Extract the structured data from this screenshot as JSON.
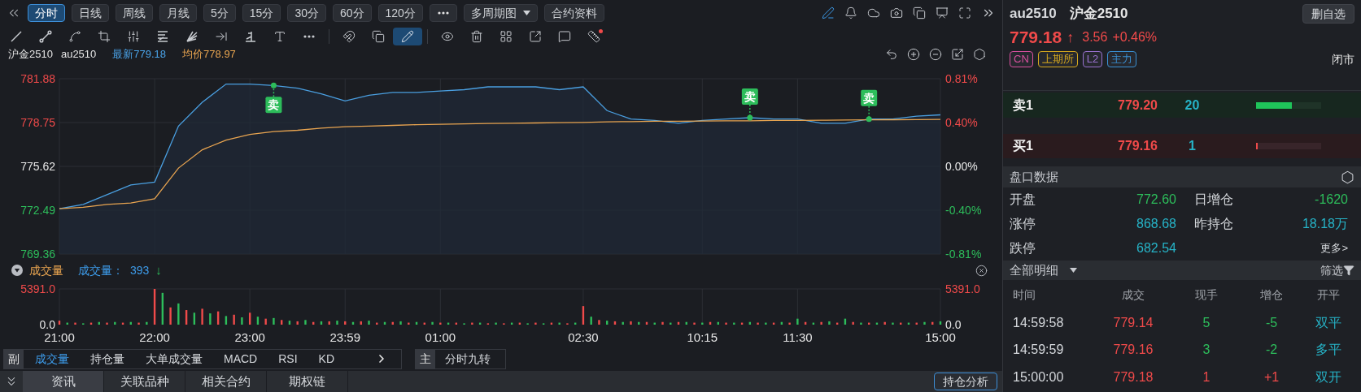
{
  "periods": [
    {
      "label": "分时",
      "selected": true
    },
    {
      "label": "日线",
      "selected": false
    },
    {
      "label": "周线",
      "selected": false
    },
    {
      "label": "月线",
      "selected": false
    },
    {
      "label": "5分",
      "selected": false
    },
    {
      "label": "15分",
      "selected": false
    },
    {
      "label": "30分",
      "selected": false
    },
    {
      "label": "60分",
      "selected": false
    },
    {
      "label": "120分",
      "selected": false
    }
  ],
  "period_menus": [
    {
      "label": "多周期图",
      "kind": "dropdown"
    },
    {
      "label": "合约资料",
      "kind": "plain"
    }
  ],
  "top_actions": [
    {
      "kind": "pen",
      "active": true
    },
    {
      "kind": "bell",
      "active": false
    },
    {
      "kind": "cloud",
      "active": false
    },
    {
      "kind": "camera",
      "active": false
    },
    {
      "kind": "copy",
      "active": false
    },
    {
      "kind": "monitor",
      "active": false
    },
    {
      "kind": "fullscreen",
      "active": false
    },
    {
      "kind": "expand",
      "active": false
    }
  ],
  "drawing_tools": [
    {
      "kind": "line",
      "selected": false
    },
    {
      "kind": "segment",
      "selected": false
    },
    {
      "kind": "path",
      "selected": false
    },
    {
      "kind": "crop",
      "selected": false
    },
    {
      "kind": "sliders",
      "selected": false
    },
    {
      "kind": "fib",
      "selected": false
    },
    {
      "kind": "fan",
      "selected": false
    },
    {
      "kind": "measure",
      "selected": false
    },
    {
      "kind": "angle",
      "selected": false
    },
    {
      "kind": "text",
      "selected": false
    },
    {
      "kind": "more",
      "selected": false
    }
  ],
  "edit_tools": [
    {
      "kind": "magnet",
      "selected": false
    },
    {
      "kind": "layers",
      "selected": false
    },
    {
      "kind": "pencil",
      "selected": true
    }
  ],
  "view_tools": [
    {
      "kind": "eye"
    },
    {
      "kind": "trash"
    },
    {
      "kind": "grid"
    },
    {
      "kind": "export"
    },
    {
      "kind": "comment"
    },
    {
      "kind": "ruler",
      "alert": true
    }
  ],
  "quote_line": {
    "name": "沪金2510",
    "code": "au2510",
    "last": "最新779.18",
    "avg": "均价778.97"
  },
  "price_chart": {
    "right_axis": [
      "0.81%",
      "0.40%",
      "0.00%",
      "-0.40%",
      "-0.81%"
    ],
    "chart_data": {
      "type": "area",
      "grid": true,
      "categories": [
        null,
        null,
        null,
        null,
        null,
        null,
        null,
        null,
        null,
        null,
        null,
        null,
        null,
        null,
        null,
        null,
        null,
        null,
        null,
        null,
        null,
        null,
        null,
        null,
        null,
        null,
        null,
        null,
        null,
        null,
        null,
        null,
        null,
        null,
        null,
        null,
        null,
        null
      ],
      "series": [
        {
          "type": "area",
          "color": "#4a9fe0",
          "values": [
            772.6,
            772.9,
            773.6,
            774.3,
            774.5,
            778.5,
            780.2,
            781.5,
            781.5,
            781.4,
            781.2,
            780.8,
            780.3,
            780.7,
            780.9,
            780.9,
            781.0,
            781.1,
            781.3,
            781.3,
            781.3,
            781.1,
            781.3,
            779.6,
            779.0,
            778.9,
            778.7,
            778.9,
            779.0,
            779.1,
            779.0,
            779.0,
            778.7,
            778.7,
            779.0,
            779.0,
            779.2,
            779.3
          ]
        },
        {
          "type": "scatter",
          "name": "卖",
          "color": "#2dbd5b",
          "values": [
            null,
            null,
            null,
            null,
            null,
            null,
            null,
            null,
            null,
            781.4,
            null,
            null,
            null,
            null,
            null,
            null,
            null,
            null,
            null,
            null,
            null,
            null,
            null,
            null,
            null,
            null,
            null,
            null,
            null,
            779.1,
            null,
            null,
            null,
            null,
            779.0,
            null,
            null,
            null
          ]
        },
        {
          "type": "line",
          "color": "#e8a450",
          "values": [
            772.6,
            772.7,
            772.9,
            773.0,
            773.3,
            775.5,
            776.8,
            777.5,
            777.9,
            778.1,
            778.2,
            778.35,
            778.45,
            778.5,
            778.55,
            778.6,
            778.62,
            778.65,
            778.68,
            778.7,
            778.72,
            778.74,
            778.76,
            778.8,
            778.82,
            778.84,
            778.85,
            778.86,
            778.87,
            778.88,
            778.9,
            778.9,
            778.92,
            778.93,
            778.94,
            778.95,
            778.96,
            778.97
          ]
        }
      ],
      "ylim": [
        769.36,
        781.88
      ],
      "yticks": [
        {
          "value": 781.88,
          "label": "781.88"
        },
        {
          "value": 778.75,
          "label": "778.75"
        },
        {
          "value": 775.62,
          "label": "775.62"
        },
        {
          "value": 772.49,
          "label": "772.49"
        },
        {
          "value": 769.36,
          "label": "769.36"
        }
      ]
    }
  },
  "volume_panel": {
    "title": "成交量",
    "reading_label": "成交量：",
    "reading": "393",
    "arrow": "↓",
    "right_labels": [
      "5391.0",
      "0.0"
    ],
    "chart_data": {
      "type": "bar",
      "grid": true,
      "ylim": [
        0,
        5391
      ],
      "categories": [
        "21:00",
        null,
        null,
        null,
        null,
        null,
        null,
        null,
        null,
        null,
        null,
        null,
        "22:00",
        null,
        null,
        null,
        null,
        null,
        null,
        null,
        null,
        null,
        null,
        null,
        "23:00",
        null,
        null,
        null,
        null,
        null,
        null,
        null,
        null,
        null,
        null,
        null,
        "23:59",
        null,
        null,
        null,
        null,
        null,
        null,
        null,
        null,
        null,
        null,
        null,
        "01:00",
        null,
        null,
        null,
        null,
        null,
        null,
        null,
        null,
        null,
        null,
        null,
        null,
        null,
        null,
        null,
        null,
        null,
        "02:30",
        null,
        null,
        null,
        null,
        null,
        null,
        null,
        null,
        null,
        null,
        null,
        null,
        null,
        null,
        "10:15",
        null,
        null,
        null,
        null,
        null,
        null,
        null,
        null,
        null,
        null,
        null,
        "11:30",
        null,
        null,
        null,
        null,
        null,
        null,
        null,
        null,
        null,
        null,
        null,
        null,
        null,
        null,
        null,
        null,
        null,
        "15:00"
      ],
      "yticks": [
        {
          "value": 5391,
          "label": "5391.0"
        },
        {
          "value": 0,
          "label": "0.0"
        }
      ],
      "series": [
        {
          "color": "#f04a4a",
          "values": [
            600,
            null,
            300,
            null,
            300,
            null,
            300,
            null,
            300,
            null,
            300,
            null,
            5391,
            null,
            2600,
            null,
            2200,
            null,
            2400,
            null,
            2000,
            null,
            1500,
            null,
            1800,
            null,
            900,
            null,
            700,
            null,
            500,
            null,
            400,
            null,
            500,
            null,
            500,
            null,
            500,
            null,
            300,
            null,
            400,
            null,
            300,
            null,
            300,
            null,
            300,
            null,
            300,
            null,
            300,
            null,
            200,
            null,
            200,
            null,
            300,
            null,
            300,
            null,
            300,
            null,
            200,
            null,
            2800,
            null,
            700,
            null,
            500,
            null,
            500,
            null,
            400,
            null,
            400,
            null,
            400,
            null,
            300,
            null,
            400,
            null,
            300,
            null,
            300,
            null,
            300,
            null,
            300,
            null,
            300,
            null,
            400,
            null,
            400,
            null,
            300,
            null,
            400,
            null,
            300,
            null,
            400,
            null,
            300,
            null,
            300,
            null,
            400,
            null
          ]
        },
        {
          "color": "#2dbd5b",
          "values": [
            null,
            300,
            null,
            200,
            null,
            400,
            null,
            400,
            null,
            400,
            null,
            400,
            null,
            4800,
            null,
            3200,
            null,
            1800,
            null,
            1700,
            null,
            1300,
            null,
            1100,
            null,
            1200,
            null,
            1000,
            null,
            600,
            null,
            700,
            null,
            500,
            null,
            600,
            null,
            400,
            null,
            600,
            null,
            400,
            null,
            500,
            null,
            400,
            null,
            400,
            null,
            300,
            null,
            200,
            null,
            300,
            null,
            300,
            null,
            300,
            null,
            200,
            null,
            200,
            null,
            300,
            null,
            300,
            null,
            1200,
            null,
            600,
            null,
            400,
            null,
            400,
            null,
            300,
            null,
            300,
            null,
            400,
            null,
            300,
            null,
            400,
            null,
            300,
            null,
            400,
            null,
            300,
            null,
            400,
            null,
            900,
            null,
            300,
            null,
            500,
            null,
            900,
            null,
            300,
            null,
            300,
            null,
            300,
            null,
            300,
            null,
            400,
            null,
            500
          ]
        }
      ]
    }
  },
  "indicators": {
    "prefix": "副",
    "tabs": [
      {
        "label": "成交量",
        "selected": true
      },
      {
        "label": "持仓量",
        "selected": false
      },
      {
        "label": "大单成交量",
        "selected": false
      },
      {
        "label": "MACD",
        "selected": false
      },
      {
        "label": "RSI",
        "selected": false
      },
      {
        "label": "KD",
        "selected": false
      }
    ],
    "main_prefix": "主",
    "main_tabs": [
      {
        "label": "分时九转",
        "selected": false
      }
    ]
  },
  "bottom_tabs": [
    {
      "label": "资讯",
      "selected": true
    },
    {
      "label": "关联品种",
      "selected": false
    },
    {
      "label": "相关合约",
      "selected": false
    },
    {
      "label": "期权链",
      "selected": false
    }
  ],
  "bottom_button": "持仓分析",
  "quote": {
    "code": "au2510",
    "name": "沪金2510",
    "action": "删自选",
    "price": "779.18",
    "arrow": "↑",
    "change": "3.56",
    "change_pct": "+0.46%",
    "status": "闭市",
    "tags": [
      {
        "label": "CN",
        "color": "#d9509f"
      },
      {
        "label": "上期所",
        "color": "#d6a81e"
      },
      {
        "label": "L2",
        "color": "#9a72d0"
      },
      {
        "label": "主力",
        "color": "#3a90d4"
      }
    ]
  },
  "order_book": [
    {
      "kind": "ask",
      "label": "卖1",
      "price": "779.20",
      "volume": "20",
      "level": 0.55
    },
    {
      "kind": "bid",
      "label": "买1",
      "price": "779.16",
      "volume": "1",
      "level": 0.03
    }
  ],
  "stats": {
    "title": "盘口数据",
    "more": "更多>",
    "cells": [
      {
        "label": "开盘",
        "value": "772.60",
        "color": "#2dbd5b"
      },
      {
        "label": "日增仓",
        "value": "-1620",
        "color": "#2dbd5b"
      },
      {
        "label": "涨停",
        "value": "868.68",
        "color": "#26b3c7"
      },
      {
        "label": "昨持仓",
        "value": "18.18万",
        "color": "#26b3c7"
      },
      {
        "label": "跌停",
        "value": "682.54",
        "color": "#26b3c7"
      }
    ]
  },
  "trades": {
    "title": "全部明细",
    "filter": "筛选",
    "columns": [
      "时间",
      "成交",
      "现手",
      "增仓",
      "开平"
    ],
    "rows": [
      {
        "time": "14:59:58",
        "price": "779.14",
        "volume": "5",
        "oi": "-5",
        "color": "#2dbd5b",
        "type": "双平"
      },
      {
        "time": "14:59:59",
        "price": "779.16",
        "volume": "3",
        "oi": "-2",
        "color": "#2dbd5b",
        "type": "多平"
      },
      {
        "time": "15:00:00",
        "price": "779.18",
        "volume": "1",
        "oi": "+1",
        "color": "#f04a4a",
        "type": "双开"
      }
    ]
  }
}
